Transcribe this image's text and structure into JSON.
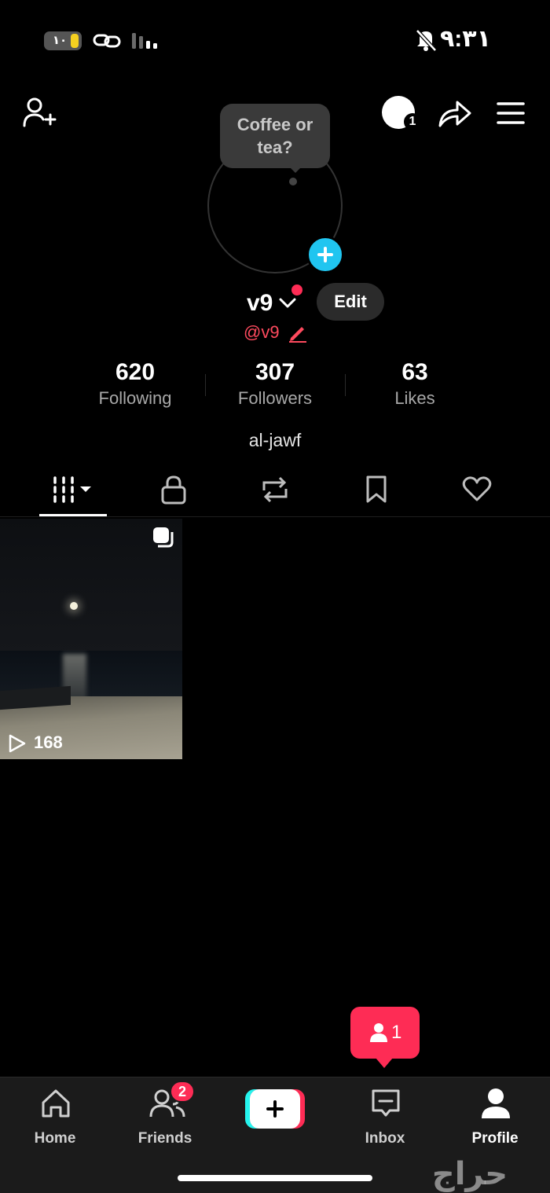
{
  "status_bar": {
    "battery_level": "١٠",
    "time": "٩:٣١"
  },
  "tooltip": {
    "text": "Coffee or tea?"
  },
  "story": {
    "count": "1"
  },
  "profile": {
    "name": "v9",
    "handle": "@v9",
    "edit_label": "Edit",
    "bio": "al-jawf"
  },
  "stats": [
    {
      "value": "620",
      "label": "Following"
    },
    {
      "value": "307",
      "label": "Followers"
    },
    {
      "value": "63",
      "label": "Likes"
    }
  ],
  "tabs": [
    {
      "icon": "grid-icon",
      "active": true
    },
    {
      "icon": "lock-icon",
      "active": false
    },
    {
      "icon": "repost-icon",
      "active": false
    },
    {
      "icon": "bookmark-icon",
      "active": false
    },
    {
      "icon": "heart-icon",
      "active": false
    }
  ],
  "videos": [
    {
      "views": "168",
      "multi_clip": true
    }
  ],
  "notification": {
    "count": "1"
  },
  "bottom_nav": {
    "items": [
      {
        "label": "Home",
        "icon": "home-icon",
        "active": false
      },
      {
        "label": "Friends",
        "icon": "friends-icon",
        "active": false,
        "badge": "2"
      },
      {
        "label": "",
        "icon": "create-plus-icon",
        "active": false
      },
      {
        "label": "Inbox",
        "icon": "inbox-icon",
        "active": false
      },
      {
        "label": "Profile",
        "icon": "profile-icon",
        "active": true
      }
    ]
  },
  "watermark": "حراج",
  "colors": {
    "accent_pink": "#fe2c55",
    "accent_cyan": "#25f4ee",
    "avatar_add_blue": "#20c5f0",
    "handle_red": "#fe4a5e"
  }
}
